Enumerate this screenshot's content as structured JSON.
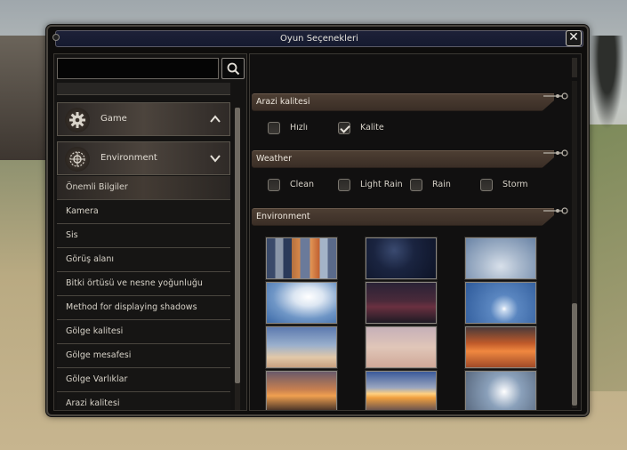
{
  "window": {
    "title": "Oyun Seçenekleri",
    "close_glyph": "✕"
  },
  "search": {
    "value": "",
    "placeholder": ""
  },
  "categories": [
    {
      "label": "Game",
      "icon": "gear-icon",
      "state": "collapsed"
    },
    {
      "label": "Environment",
      "icon": "environment-icon",
      "state": "expanded"
    }
  ],
  "menu": {
    "items": [
      "Önemli Bilgiler",
      "Kamera",
      "Sis",
      "Görüş alanı",
      "Bitki örtüsü ve nesne yoğunluğu",
      "Method for displaying shadows",
      "Gölge kalitesi",
      "Gölge mesafesi",
      "Gölge Varlıklar",
      "Arazi kalitesi"
    ],
    "active_index": 0
  },
  "sections": {
    "arazi": {
      "title": "Arazi kalitesi",
      "options": [
        {
          "label": "Hızlı",
          "checked": false
        },
        {
          "label": "Kalite",
          "checked": true
        }
      ]
    },
    "weather": {
      "title": "Weather",
      "options": [
        {
          "label": "Clean",
          "checked": false
        },
        {
          "label": "Light Rain",
          "checked": false
        },
        {
          "label": "Rain",
          "checked": false
        },
        {
          "label": "Storm",
          "checked": false
        }
      ]
    },
    "environment": {
      "title": "Environment",
      "thumbnails": [
        "sky-preset-strip",
        "night-sky",
        "cloudy-sky",
        "bright-clouds",
        "dusk-sky",
        "sun-blue-sky",
        "evening-clouds",
        "pastel-sunset",
        "orange-sunset",
        "sunset-horizon",
        "golden-sunrise",
        "hazy-sun"
      ]
    }
  },
  "colors": {
    "accent_section": "#4d3e33",
    "titlebar": "#1d2138",
    "panel_bg": "#111010"
  }
}
